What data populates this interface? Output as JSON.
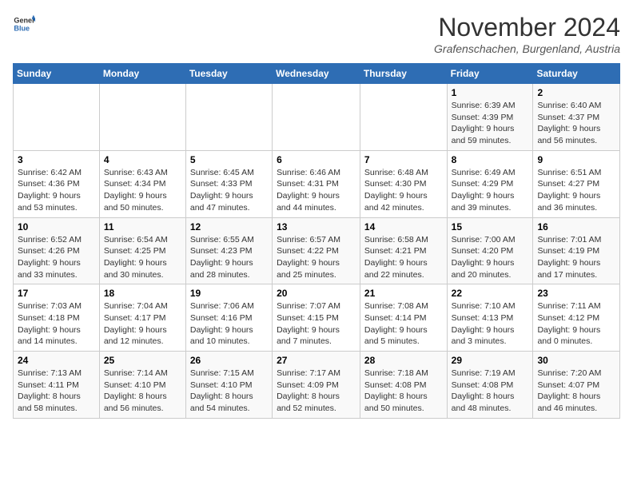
{
  "header": {
    "logo_line1": "General",
    "logo_line2": "Blue",
    "month": "November 2024",
    "location": "Grafenschachen, Burgenland, Austria"
  },
  "weekdays": [
    "Sunday",
    "Monday",
    "Tuesday",
    "Wednesday",
    "Thursday",
    "Friday",
    "Saturday"
  ],
  "weeks": [
    [
      {
        "day": "",
        "info": ""
      },
      {
        "day": "",
        "info": ""
      },
      {
        "day": "",
        "info": ""
      },
      {
        "day": "",
        "info": ""
      },
      {
        "day": "",
        "info": ""
      },
      {
        "day": "1",
        "info": "Sunrise: 6:39 AM\nSunset: 4:39 PM\nDaylight: 9 hours and 59 minutes."
      },
      {
        "day": "2",
        "info": "Sunrise: 6:40 AM\nSunset: 4:37 PM\nDaylight: 9 hours and 56 minutes."
      }
    ],
    [
      {
        "day": "3",
        "info": "Sunrise: 6:42 AM\nSunset: 4:36 PM\nDaylight: 9 hours and 53 minutes."
      },
      {
        "day": "4",
        "info": "Sunrise: 6:43 AM\nSunset: 4:34 PM\nDaylight: 9 hours and 50 minutes."
      },
      {
        "day": "5",
        "info": "Sunrise: 6:45 AM\nSunset: 4:33 PM\nDaylight: 9 hours and 47 minutes."
      },
      {
        "day": "6",
        "info": "Sunrise: 6:46 AM\nSunset: 4:31 PM\nDaylight: 9 hours and 44 minutes."
      },
      {
        "day": "7",
        "info": "Sunrise: 6:48 AM\nSunset: 4:30 PM\nDaylight: 9 hours and 42 minutes."
      },
      {
        "day": "8",
        "info": "Sunrise: 6:49 AM\nSunset: 4:29 PM\nDaylight: 9 hours and 39 minutes."
      },
      {
        "day": "9",
        "info": "Sunrise: 6:51 AM\nSunset: 4:27 PM\nDaylight: 9 hours and 36 minutes."
      }
    ],
    [
      {
        "day": "10",
        "info": "Sunrise: 6:52 AM\nSunset: 4:26 PM\nDaylight: 9 hours and 33 minutes."
      },
      {
        "day": "11",
        "info": "Sunrise: 6:54 AM\nSunset: 4:25 PM\nDaylight: 9 hours and 30 minutes."
      },
      {
        "day": "12",
        "info": "Sunrise: 6:55 AM\nSunset: 4:23 PM\nDaylight: 9 hours and 28 minutes."
      },
      {
        "day": "13",
        "info": "Sunrise: 6:57 AM\nSunset: 4:22 PM\nDaylight: 9 hours and 25 minutes."
      },
      {
        "day": "14",
        "info": "Sunrise: 6:58 AM\nSunset: 4:21 PM\nDaylight: 9 hours and 22 minutes."
      },
      {
        "day": "15",
        "info": "Sunrise: 7:00 AM\nSunset: 4:20 PM\nDaylight: 9 hours and 20 minutes."
      },
      {
        "day": "16",
        "info": "Sunrise: 7:01 AM\nSunset: 4:19 PM\nDaylight: 9 hours and 17 minutes."
      }
    ],
    [
      {
        "day": "17",
        "info": "Sunrise: 7:03 AM\nSunset: 4:18 PM\nDaylight: 9 hours and 14 minutes."
      },
      {
        "day": "18",
        "info": "Sunrise: 7:04 AM\nSunset: 4:17 PM\nDaylight: 9 hours and 12 minutes."
      },
      {
        "day": "19",
        "info": "Sunrise: 7:06 AM\nSunset: 4:16 PM\nDaylight: 9 hours and 10 minutes."
      },
      {
        "day": "20",
        "info": "Sunrise: 7:07 AM\nSunset: 4:15 PM\nDaylight: 9 hours and 7 minutes."
      },
      {
        "day": "21",
        "info": "Sunrise: 7:08 AM\nSunset: 4:14 PM\nDaylight: 9 hours and 5 minutes."
      },
      {
        "day": "22",
        "info": "Sunrise: 7:10 AM\nSunset: 4:13 PM\nDaylight: 9 hours and 3 minutes."
      },
      {
        "day": "23",
        "info": "Sunrise: 7:11 AM\nSunset: 4:12 PM\nDaylight: 9 hours and 0 minutes."
      }
    ],
    [
      {
        "day": "24",
        "info": "Sunrise: 7:13 AM\nSunset: 4:11 PM\nDaylight: 8 hours and 58 minutes."
      },
      {
        "day": "25",
        "info": "Sunrise: 7:14 AM\nSunset: 4:10 PM\nDaylight: 8 hours and 56 minutes."
      },
      {
        "day": "26",
        "info": "Sunrise: 7:15 AM\nSunset: 4:10 PM\nDaylight: 8 hours and 54 minutes."
      },
      {
        "day": "27",
        "info": "Sunrise: 7:17 AM\nSunset: 4:09 PM\nDaylight: 8 hours and 52 minutes."
      },
      {
        "day": "28",
        "info": "Sunrise: 7:18 AM\nSunset: 4:08 PM\nDaylight: 8 hours and 50 minutes."
      },
      {
        "day": "29",
        "info": "Sunrise: 7:19 AM\nSunset: 4:08 PM\nDaylight: 8 hours and 48 minutes."
      },
      {
        "day": "30",
        "info": "Sunrise: 7:20 AM\nSunset: 4:07 PM\nDaylight: 8 hours and 46 minutes."
      }
    ]
  ]
}
